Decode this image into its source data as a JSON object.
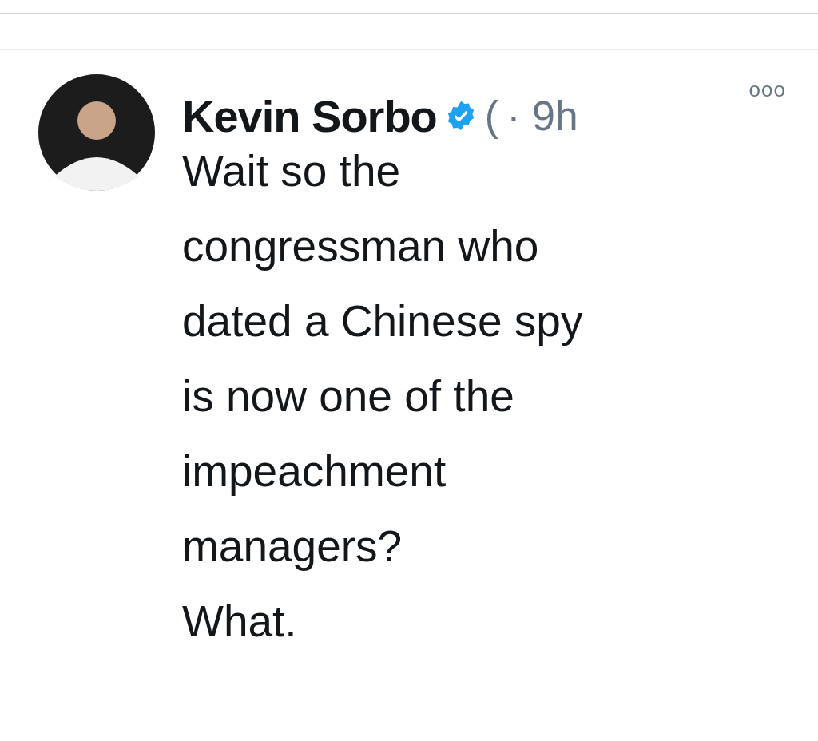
{
  "tweet": {
    "author": "Kevin Sorbo",
    "verified": true,
    "handle": "(",
    "time": "· 9h",
    "menu": "ooo",
    "text_lines": [
      "Wait so the",
      "congressman who",
      "dated a Chinese spy",
      "is now one of the",
      "impeachment",
      "managers?",
      "What."
    ]
  }
}
